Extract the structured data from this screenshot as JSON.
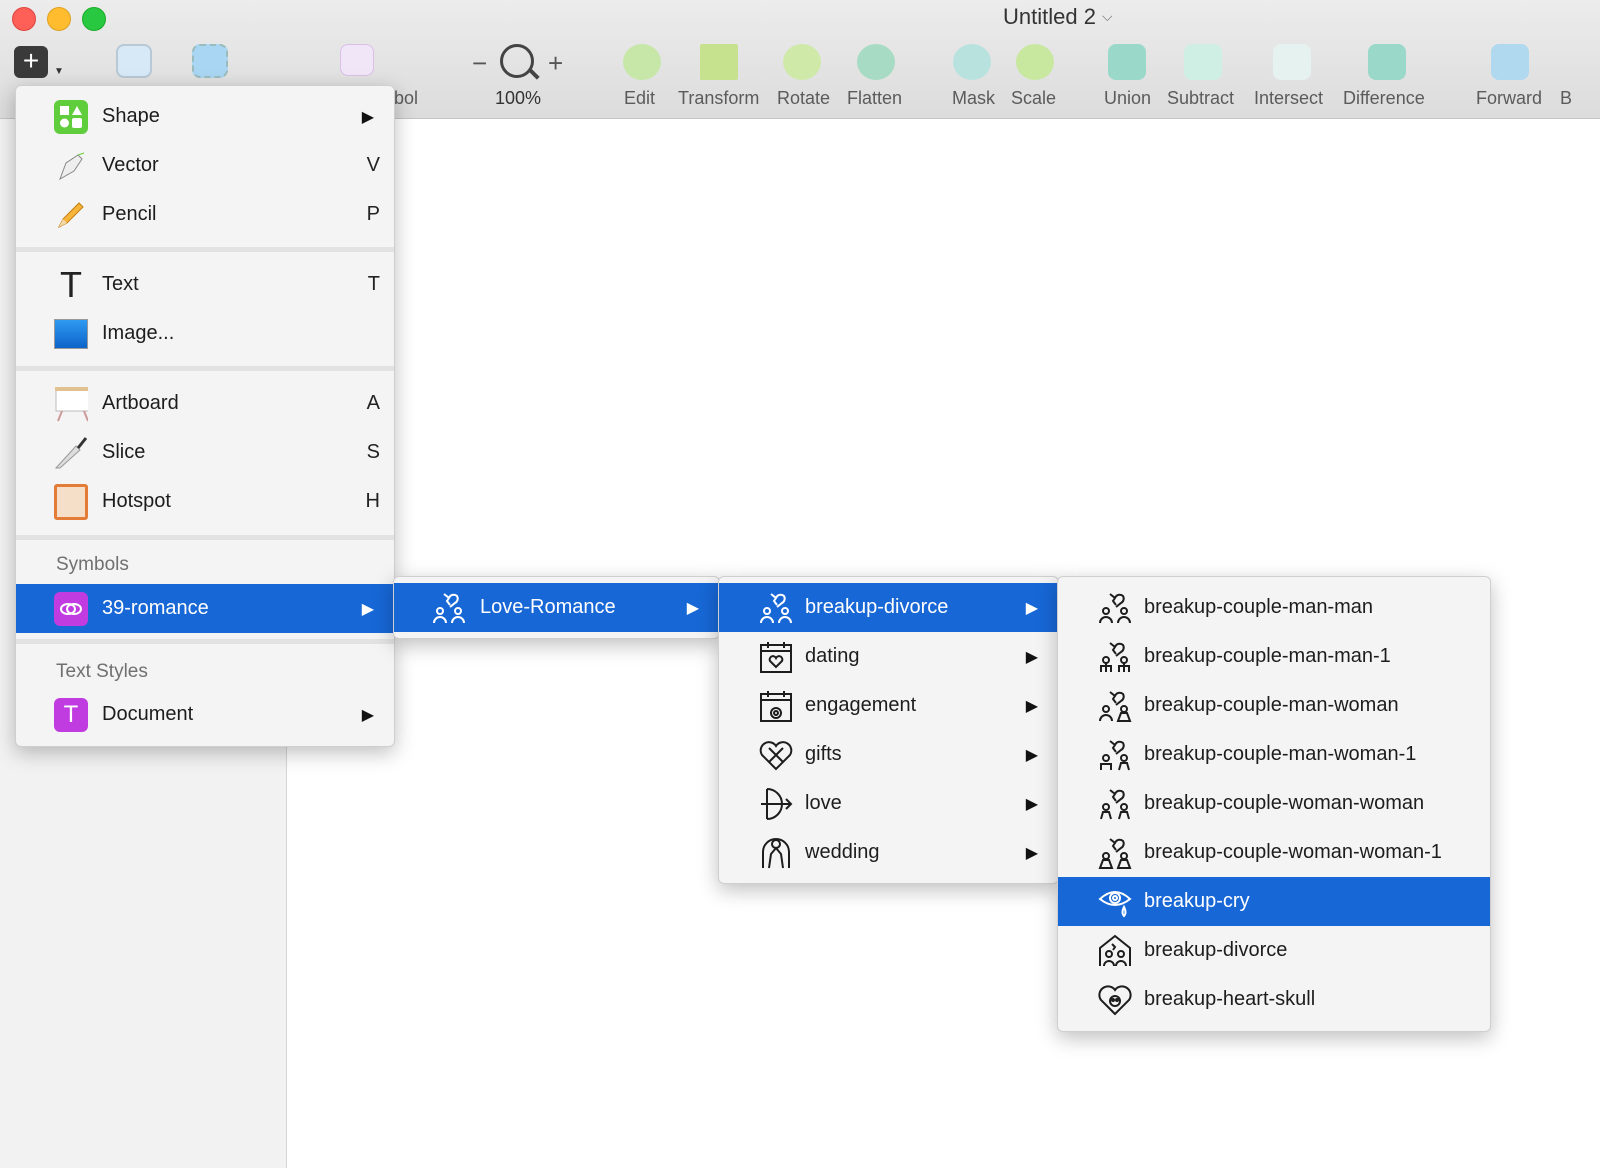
{
  "window": {
    "title": "Untitled 2"
  },
  "toolbar": {
    "zoom": "100%",
    "partial_label": "bol",
    "buttons": [
      "Edit",
      "Transform",
      "Rotate",
      "Flatten",
      "Mask",
      "Scale",
      "Union",
      "Subtract",
      "Intersect",
      "Difference",
      "Forward",
      "B"
    ]
  },
  "insert_menu": {
    "items": [
      {
        "label": "Shape",
        "shortcut": "",
        "arrow": "▶"
      },
      {
        "label": "Vector",
        "shortcut": "V"
      },
      {
        "label": "Pencil",
        "shortcut": "P"
      },
      {
        "label": "Text",
        "shortcut": "T"
      },
      {
        "label": "Image...",
        "shortcut": ""
      },
      {
        "label": "Artboard",
        "shortcut": "A"
      },
      {
        "label": "Slice",
        "shortcut": "S"
      },
      {
        "label": "Hotspot",
        "shortcut": "H"
      }
    ],
    "symbols_header": "Symbols",
    "symbols_item": "39-romance",
    "text_styles_header": "Text Styles",
    "text_styles_item": "Document",
    "arrow": "▶"
  },
  "love_menu": {
    "item": "Love-Romance"
  },
  "category_menu": {
    "items": [
      "breakup-divorce",
      "dating",
      "engagement",
      "gifts",
      "love",
      "wedding"
    ]
  },
  "symbol_menu": {
    "items": [
      "breakup-couple-man-man",
      "breakup-couple-man-man-1",
      "breakup-couple-man-woman",
      "breakup-couple-man-woman-1",
      "breakup-couple-woman-woman",
      "breakup-couple-woman-woman-1",
      "breakup-cry",
      "breakup-divorce",
      "breakup-heart-skull"
    ],
    "selected": "breakup-cry"
  },
  "colors": {
    "highlight": "#1767d6",
    "menu_bg": "#f4f4f4",
    "symbol_purple": "#c03ce0"
  }
}
